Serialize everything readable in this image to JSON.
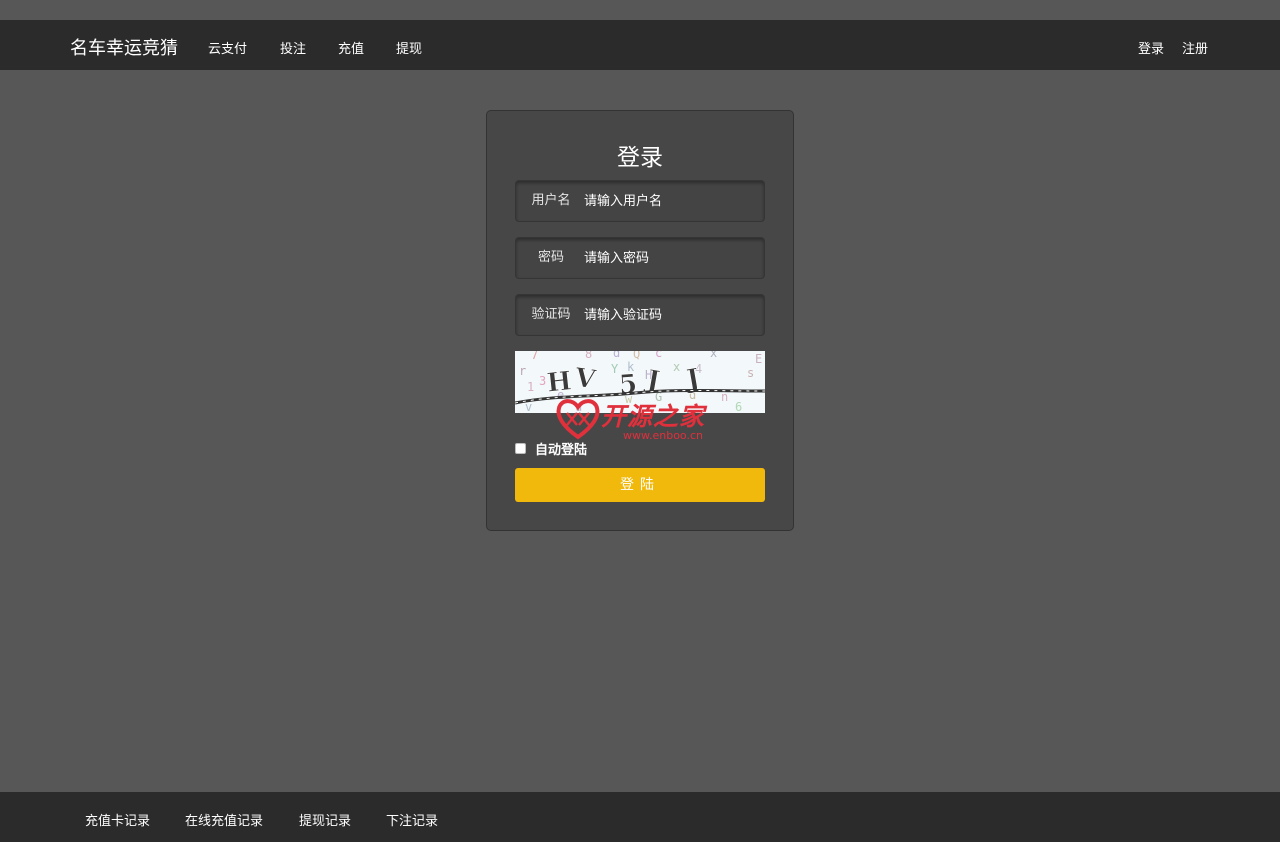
{
  "navbar": {
    "brand": "名车幸运竞猜",
    "items": [
      "云支付",
      "投注",
      "充值",
      "提现"
    ],
    "right": {
      "login": "登录",
      "register": "注册"
    }
  },
  "login_form": {
    "title": "登录",
    "fields": [
      {
        "label": "用户名",
        "placeholder": "请输入用户名"
      },
      {
        "label": "密码",
        "placeholder": "请输入密码"
      },
      {
        "label": "验证码",
        "placeholder": "请输入验证码"
      }
    ],
    "captcha_text": "HV5JJ",
    "watermark": {
      "text": "开源之家",
      "url": "www.enboo.cn"
    },
    "remember_label": "自动登陆",
    "submit_label": "登陆"
  },
  "footer": {
    "links": [
      "充值卡记录",
      "在线充值记录",
      "提现记录",
      "下注记录"
    ]
  },
  "colors": {
    "page_bg": "#575757",
    "bar_bg": "#2b2b2b",
    "card_bg": "#474747",
    "accent": "#f0b90b",
    "watermark": "#e0303c"
  }
}
